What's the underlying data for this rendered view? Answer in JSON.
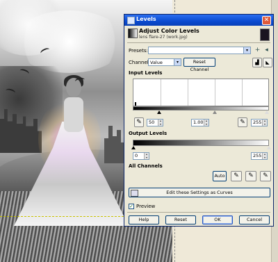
{
  "window": {
    "title": "Levels",
    "close_glyph": "✕"
  },
  "header": {
    "title": "Adjust Color Levels",
    "subtitle": "lens flare-27 (work.jpg)"
  },
  "presets": {
    "label": "Presets:",
    "value": "",
    "add_glyph": "+",
    "menu_glyph": "◂"
  },
  "channel": {
    "label": "Channel:",
    "value": "Value",
    "reset_label": "Reset Channel"
  },
  "input_levels": {
    "heading": "Input Levels",
    "low": "50",
    "gamma": "1.00",
    "high": "255",
    "low_fraction": 0.196,
    "gamma_fraction": 0.6,
    "high_fraction": 1.0
  },
  "output_levels": {
    "heading": "Output Levels",
    "low": "0",
    "high": "255"
  },
  "all_channels": {
    "heading": "All Channels",
    "auto_label": "Auto"
  },
  "edit_curves_label": "Edit these Settings as Curves",
  "preview": {
    "label": "Preview",
    "checked": true,
    "check_glyph": "✓"
  },
  "footer": {
    "help": "Help",
    "reset": "Reset",
    "ok": "OK",
    "cancel": "Cancel"
  },
  "colors": {
    "titlebar": "#0a4ad0",
    "dialog_bg": "#ece9d8",
    "button_border": "#003c74"
  },
  "icons": {
    "picker": "eyedropper-icon",
    "linear_histogram": "linear-histogram-icon",
    "log_histogram": "log-histogram-icon"
  }
}
